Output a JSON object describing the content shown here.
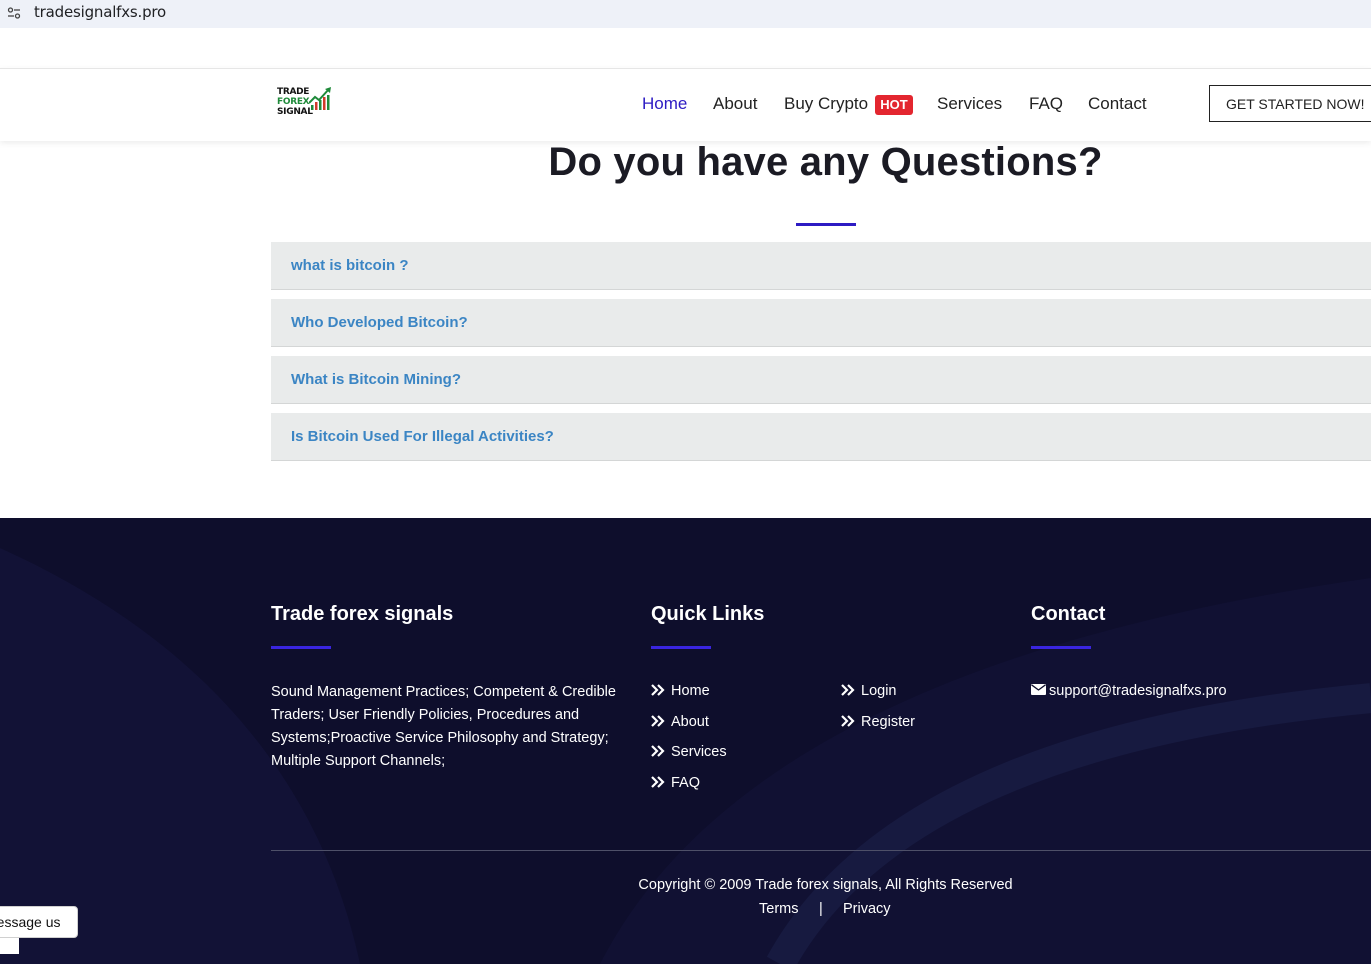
{
  "browser": {
    "url": "tradesignalfxs.pro",
    "icon": "site-settings-icon"
  },
  "header": {
    "logo_lines": [
      "TRADE",
      "FOREX",
      "SIGNAL"
    ],
    "logo_icon": "chart-bars-icon",
    "nav": [
      {
        "label": "Home",
        "active": true
      },
      {
        "label": "About"
      },
      {
        "label": "Buy Crypto"
      },
      {
        "label": "Services"
      },
      {
        "label": "FAQ"
      },
      {
        "label": "Contact"
      }
    ],
    "hot_badge": "HOT",
    "cta_label": "GET STARTED NOW!"
  },
  "faq": {
    "title": "Do you have any Questions?",
    "items": [
      "what is bitcoin ?",
      "Who Developed Bitcoin?",
      "What is Bitcoin Mining?",
      "Is Bitcoin Used For Illegal Activities?"
    ]
  },
  "footer": {
    "about": {
      "heading": "Trade forex signals",
      "text": "Sound Management Practices; Competent & Credible Traders; User Friendly Policies, Procedures and Systems;Proactive Service Philosophy and Strategy; Multiple Support Channels;"
    },
    "quick_links": {
      "heading": "Quick Links",
      "col1": [
        "Home",
        "About",
        "Services",
        "FAQ"
      ],
      "col2": [
        "Login",
        "Register"
      ]
    },
    "contact": {
      "heading": "Contact",
      "email": "support@tradesignalfxs.pro",
      "icon": "envelope-icon"
    },
    "copyright": "Copyright © 2009 Trade forex signals, All Rights Reserved",
    "legal": {
      "terms": "Terms",
      "separator": "|",
      "privacy": "Privacy"
    }
  },
  "chat_widget": {
    "label": "Message us"
  },
  "colors": {
    "accent": "#2d1bc3",
    "faq_question": "#3b85c4",
    "hot": "#e3262f",
    "footer_bg": "#0e0e2c"
  }
}
